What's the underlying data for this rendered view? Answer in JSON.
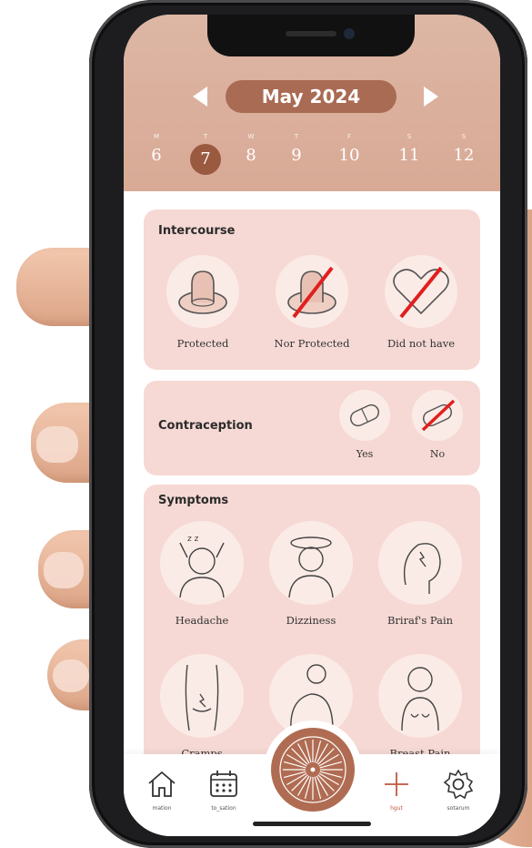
{
  "calendar": {
    "month_label": "May 2024",
    "weekday_initials": [
      "M",
      "T",
      "W",
      "T",
      "F",
      "S",
      "S"
    ],
    "days": [
      "6",
      "7",
      "8",
      "9",
      "10",
      "11",
      "12"
    ],
    "selected_day": "7"
  },
  "intercourse": {
    "title": "Intercourse",
    "options": [
      {
        "label": "Protected",
        "icon": "condom-icon"
      },
      {
        "label": "Nor Protected",
        "icon": "condom-crossed-icon"
      },
      {
        "label": "Did not have",
        "icon": "heart-crossed-icon"
      }
    ]
  },
  "contraception": {
    "title": "Contraception",
    "options": [
      {
        "label": "Yes",
        "icon": "pill-icon"
      },
      {
        "label": "No",
        "icon": "pill-crossed-icon"
      }
    ]
  },
  "symptoms": {
    "title": "Symptoms",
    "options": [
      {
        "label": "Headache",
        "icon": "headache-icon"
      },
      {
        "label": "Dizziness",
        "icon": "dizziness-icon"
      },
      {
        "label": "Briraf's Pain",
        "icon": "head-pain-icon"
      },
      {
        "label": "Cramps",
        "icon": "cramps-icon"
      },
      {
        "label": "",
        "icon": "back-pain-icon"
      },
      {
        "label": "Breast Pain",
        "icon": "breast-pain-icon"
      }
    ]
  },
  "tabbar": {
    "items": [
      {
        "label": "mation",
        "icon": "home-icon"
      },
      {
        "label": "to_sation",
        "icon": "calendar-icon"
      },
      {
        "label": "hgut",
        "icon": "plus-icon"
      },
      {
        "label": "sotarum",
        "icon": "gear-icon"
      }
    ],
    "center_icon": "flower-icon"
  },
  "colors": {
    "header": "#d8aa96",
    "accent": "#a96b53",
    "card": "#f6d9d4",
    "cross": "#e0201e"
  }
}
